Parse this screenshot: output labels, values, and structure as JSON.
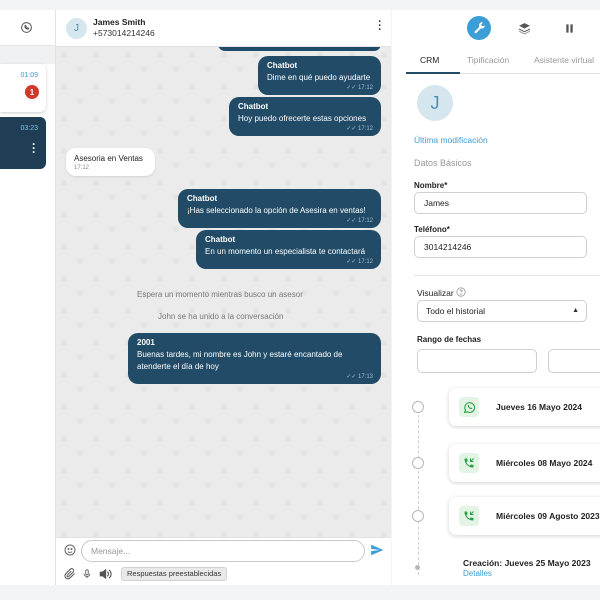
{
  "colors": {
    "accent": "#3b9ed6",
    "bubble": "#214b67",
    "badge": "#d0382a",
    "whatsapp": "#25a244"
  },
  "sidebar": {
    "items": [
      {
        "time": "01:09",
        "unread": "1"
      },
      {
        "time": "03:23"
      }
    ]
  },
  "chat": {
    "contact": {
      "initial": "J",
      "name": "James Smith",
      "phone": "+573014214246"
    },
    "messages": [
      {
        "direction": "out",
        "sender": "Chatbot",
        "text": "Dime en qué puedo ayudarte",
        "time": "17:12"
      },
      {
        "direction": "out",
        "sender": "Chatbot",
        "text": "Hoy puedo ofrecerte estas opciones",
        "time": "17:12"
      },
      {
        "direction": "in",
        "text": "Asesoria en Ventas",
        "time": "17:12"
      },
      {
        "direction": "out",
        "sender": "Chatbot",
        "text": "¡Has seleccionado la opción de Asesira en ventas!",
        "time": "17:12"
      },
      {
        "direction": "out",
        "sender": "Chatbot",
        "text": "En un momento un especialista te contactará",
        "time": "17:12"
      },
      {
        "direction": "out",
        "sender": "2001",
        "text_line1": "Buenas tardes, mi nombre es John y estaré encantado de",
        "text_line2": "atenderte el día de hoy",
        "time": "17:13"
      }
    ],
    "system": [
      "Espera un momento mientras busco un asesor",
      "John se ha unido a la conversación"
    ],
    "composer": {
      "placeholder": "Mensaje...",
      "quick_replies_label": "Respuestas preestablecidas"
    }
  },
  "panel": {
    "tools": [
      "wrench-icon",
      "layers-icon",
      "pause-icon"
    ],
    "tabs": [
      "CRM",
      "Tipificación",
      "Asistente virtual"
    ],
    "active_tab": "CRM",
    "avatar_initial": "J",
    "last_modified_label": "Última modificación",
    "section_title": "Datos Básicos",
    "fields": {
      "name_label": "Nombre*",
      "name_value": "James",
      "phone_label": "Teléfono*",
      "phone_value": "3014214246"
    },
    "visualize_label": "Visualizar",
    "visualize_value": "Todo el historial",
    "date_range_label": "Rango de fechas",
    "timeline": [
      {
        "channel": "whatsapp-icon",
        "date": "Jueves 16 Mayo 2024"
      },
      {
        "channel": "phone-incoming-icon",
        "date": "Miércoles 08 Mayo 2024"
      },
      {
        "channel": "phone-incoming-icon",
        "date": "Miércoles 09 Agosto 2023"
      }
    ],
    "creation_label": "Creación: Jueves 25 Mayo 2023",
    "details_link": "Detalles"
  }
}
